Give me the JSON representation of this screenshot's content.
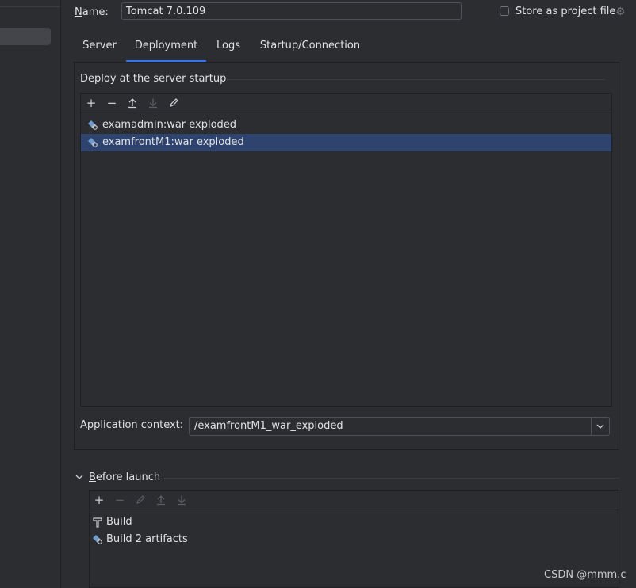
{
  "name": {
    "label": "Name:",
    "value": "Tomcat 7.0.109"
  },
  "store_as_project_file": {
    "label": "Store as project file",
    "checked": false
  },
  "tabs": [
    {
      "label": "Server",
      "active": false
    },
    {
      "label": "Deployment",
      "active": true
    },
    {
      "label": "Logs",
      "active": false
    },
    {
      "label": "Startup/Connection",
      "active": false
    }
  ],
  "deploy": {
    "title": "Deploy at the server startup",
    "toolbar": [
      "add-icon",
      "remove-icon",
      "move-up-icon",
      "move-down-icon",
      "edit-icon"
    ],
    "items": [
      {
        "label": "examadmin:war exploded",
        "selected": false
      },
      {
        "label": "examfrontM1:war exploded",
        "selected": true
      }
    ]
  },
  "app_context": {
    "label": "Application context:",
    "value": "/examfrontM1_war_exploded"
  },
  "before_launch": {
    "title": "Before launch",
    "toolbar": [
      "add-icon",
      "remove-icon",
      "edit-icon",
      "move-up-icon",
      "move-down-icon"
    ],
    "items": [
      {
        "label": "Build",
        "icon": "build-icon"
      },
      {
        "label": "Build 2 artifacts",
        "icon": "artifact-icon"
      }
    ]
  },
  "watermark": "CSDN @mmm.c",
  "colors": {
    "background": "#2b2d30",
    "selection": "#2e436e",
    "accent": "#3574f0",
    "text": "#dfe1e5"
  }
}
